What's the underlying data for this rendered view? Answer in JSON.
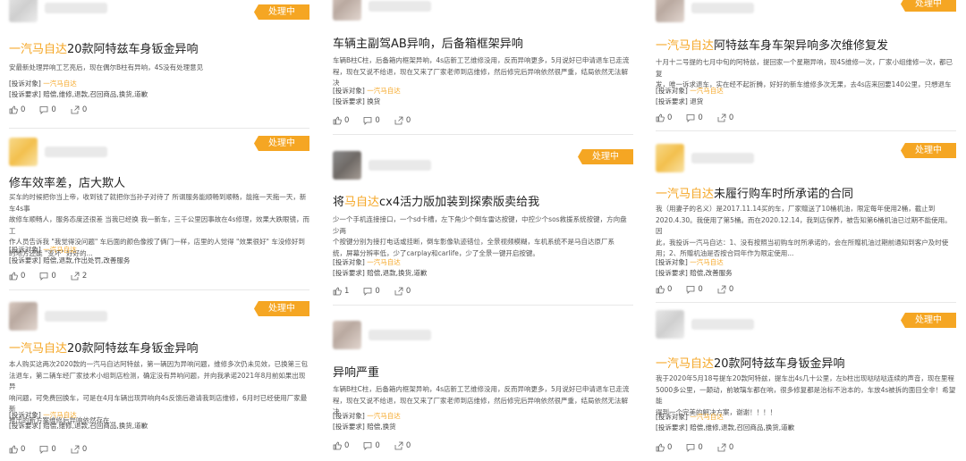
{
  "status_badge": "处理中",
  "labels": {
    "target": "[投诉对象]",
    "demand": "[投诉要求]"
  },
  "columns": [
    {
      "cards": [
        {
          "brand": "一汽马自达",
          "title_rest": "20款阿特兹车身钣金异响",
          "desc": [
            "安最新处理异响工艺亮后，现在偶尔B柱有异响，4S没有处理意见"
          ],
          "target": "一汽马自达",
          "demand": "赔偿,维修,退款,召回商品,换货,道歉",
          "likes": "0",
          "comments": "0",
          "shares": "0"
        },
        {
          "brand": "",
          "title_rest": "修车效率差，店大欺人",
          "desc": [
            "买车的时候把你当上帝，收到钱了就把你当孙子对待了 所谓服务能顺畅到顺畅，能拖一天拖一天，新车4s事",
            "故修车顺畅人，服务态度还很差 当我已经换 我一新车，三千公里因事故在4s修理，效果大跌眼镜，而工",
            "作人员告诉我 \"我觉得没问题\" 车后面的颜色像按了俩门一样，店里的人觉得 \"效果很好\" 车没修好到",
            "的地方还能 \"变坏\" 好好的..."
          ],
          "target": "一汽马自达",
          "demand": "赔偿,退款,作出处罚,改善服务",
          "likes": "0",
          "comments": "0",
          "shares": "2"
        },
        {
          "brand": "一汽马自达",
          "title_rest": "20款阿特兹车身钣金异响",
          "desc": [
            "本人购买这两次2020款的一汽马自达阿特兹，第一辆因为异响问题，维修多次仍未见效，已换第三包",
            "法退车，第二辆车经厂家技术小组到店检测，确定没有异响问题，并向我承诺2021年8月前如果出现异",
            "响问题，可免费回换车，可是在4月车辆出现异响向4s反馈后邀请我到店维修，6月时已经使用厂家最新",
            "推出的新方案维修后异响依然存在..."
          ],
          "target": "一汽马自达",
          "demand": "赔偿,维修,退款,召回商品,换货,道歉",
          "likes": "0",
          "comments": "0",
          "shares": "0"
        }
      ]
    },
    {
      "cards": [
        {
          "brand": "",
          "title_rest": "车辆主副驾AB异响，后备箱框架异响",
          "desc": [
            "车辆B柱C柱，后备箱内框架异响，4s店新工艺维修没用，反而异响更多，5月说好已申请退车已走流",
            "程，现在又说不给退，现在又来了厂家老师到店维修，然后修完后异响依然很严重，结局依然无法解决"
          ],
          "target": "一汽马自达",
          "demand": "换货",
          "likes": "0",
          "comments": "0",
          "shares": "0"
        },
        {
          "brand": "马自达",
          "title_pre": "将",
          "title_rest": "cx4活力版加装到探索版卖给我",
          "desc": [
            "少一个手机连接接口，一个sd卡槽，左下角少个倒车雷达按键，中控少个sos救援系统按键，方向盘少两",
            "个按键分别为接打电话或挂断，倒车影像轨迹错位，全景视频模糊，车机系统不是马自达原厂系",
            "统，屏幕分辨率低，少了carplay和carlife，少了全景一键开启按键。"
          ],
          "target": "一汽马自达",
          "demand": "赔偿,退款,换货,道歉",
          "likes": "1",
          "comments": "0",
          "shares": "0"
        },
        {
          "brand": "",
          "title_rest": "异响严重",
          "desc": [
            "车辆B柱C柱，后备箱内框架异响，4s店新工艺维修没用，反而异响更多，5月说好已申请退车已走流",
            "程，现在又说不给退，现在又来了厂家老师到店维修，然后修完后异响依然很严重，结局依然无法解决"
          ],
          "target": "一汽马自达",
          "demand": "赔偿,换货",
          "likes": "0",
          "comments": "0",
          "shares": "0"
        }
      ]
    },
    {
      "cards": [
        {
          "brand": "一汽马自达",
          "title_rest": "阿特兹车身车架异响多次维修复发",
          "desc": [
            "十月十二号提的七月中旬的阿特兹，提回家一个星期异响，现4S维修一次，厂家小组维修一次，都已复",
            "发，唯一诉求退车，实在经不起折腾，好好的新车维修多次无果，去4s店来回要140公里，只想退车"
          ],
          "target": "一汽马自达",
          "demand": "退货",
          "likes": "0",
          "comments": "0",
          "shares": "0"
        },
        {
          "brand": "一汽马自达",
          "title_rest": "未履行购车时所承诺的合同",
          "desc": [
            "我（用妻子的名义）是2017.11.14买的车，厂家赠送了10桶机油，限定每年使用2桶，截止到",
            "2020.4.30。我使用了第5桶。而在2020.12.14，我到店保养，被告知第6桶机油已过期不能使用。因",
            "此，我投诉一汽马自达：1、没有按照当初购车时所承诺的，会在所赠机油过期前通知到客户及时使",
            "用；2、所赠机油是否按合同年作为限定使用..."
          ],
          "target": "一汽马自达",
          "demand": "赔偿,改善服务",
          "likes": "0",
          "comments": "0",
          "shares": "0"
        },
        {
          "brand": "一汽马自达",
          "title_rest": "20款阿特兹车身钣金异响",
          "desc": [
            "我于2020年5月18号提车20款阿特兹，提车出4s几十公里，左b柱出现哒哒哒连续的声音，现在里程",
            "5000多公里，一颠动，前玻璃车都在响，很多修复都是治标不治本的，车放4s被拆的面目全非！希望能",
            "得到一个完美的解决方案，谢谢！！！！"
          ],
          "target": "一汽马自达",
          "demand": "赔偿,维修,退款,召回商品,换货,道歉",
          "likes": "0",
          "comments": "0",
          "shares": "0"
        }
      ]
    }
  ]
}
